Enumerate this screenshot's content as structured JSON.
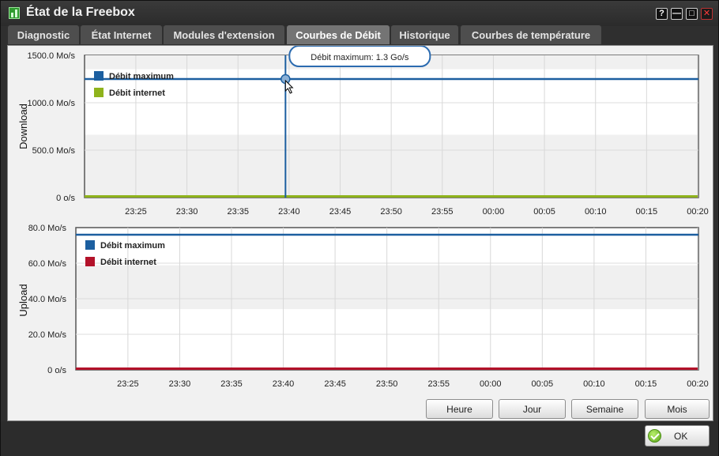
{
  "window": {
    "title": "État de la Freebox"
  },
  "titlebar_buttons": {
    "help": "?",
    "minimize": "—",
    "maximize": "□",
    "close": "✕"
  },
  "tabs": [
    {
      "label": "Diagnostic",
      "active": false
    },
    {
      "label": "État Internet",
      "active": false
    },
    {
      "label": "Modules d'extension",
      "active": false
    },
    {
      "label": "Courbes de Débit",
      "active": true
    },
    {
      "label": "Historique",
      "active": false
    },
    {
      "label": "Courbes de température",
      "active": false
    }
  ],
  "chart_data": [
    {
      "type": "line",
      "ylabel": "Download",
      "x_ticks": [
        "23:25",
        "23:30",
        "23:35",
        "23:40",
        "23:45",
        "23:50",
        "23:55",
        "00:00",
        "00:05",
        "00:10",
        "00:15",
        "00:20"
      ],
      "y_ticks": [
        "1500.0 Mo/s",
        "1000.0 Mo/s",
        "500.0 Mo/s",
        "0 o/s"
      ],
      "ylim": [
        0,
        1500
      ],
      "y_unit": "Mo/s",
      "legend": {
        "placement": "top-left",
        "entries": [
          "Débit maximum",
          "Débit internet"
        ]
      },
      "series": [
        {
          "name": "Débit maximum",
          "color": "#1c5fa0",
          "values": [
            1250,
            1250
          ]
        },
        {
          "name": "Débit internet",
          "color": "#8fb31c",
          "values": [
            2,
            2,
            2,
            2,
            2,
            8,
            2,
            2,
            2,
            2,
            2,
            2
          ]
        }
      ],
      "tooltip": {
        "text": "Débit maximum: 1.3 Go/s",
        "at_time": "23:39"
      }
    },
    {
      "type": "line",
      "ylabel": "Upload",
      "x_ticks": [
        "23:25",
        "23:30",
        "23:35",
        "23:40",
        "23:45",
        "23:50",
        "23:55",
        "00:00",
        "00:05",
        "00:10",
        "00:15",
        "00:20"
      ],
      "y_ticks": [
        "80.0 Mo/s",
        "60.0 Mo/s",
        "40.0 Mo/s",
        "20.0 Mo/s",
        "0 o/s"
      ],
      "ylim": [
        0,
        80
      ],
      "y_unit": "Mo/s",
      "legend": {
        "placement": "top-left",
        "entries": [
          "Débit maximum",
          "Débit internet"
        ]
      },
      "series": [
        {
          "name": "Débit maximum",
          "color": "#1c5fa0",
          "values": [
            76,
            76
          ]
        },
        {
          "name": "Débit internet",
          "color": "#b3122a",
          "values": [
            0.5,
            0.5,
            0.5,
            0.5,
            0.5,
            0.5,
            0.5,
            0.5,
            0.5,
            0.5,
            0.5,
            0.5
          ]
        }
      ]
    }
  ],
  "range_buttons": [
    "Heure",
    "Jour",
    "Semaine",
    "Mois"
  ],
  "ok_button": {
    "label": "OK",
    "icon": "check-icon"
  }
}
